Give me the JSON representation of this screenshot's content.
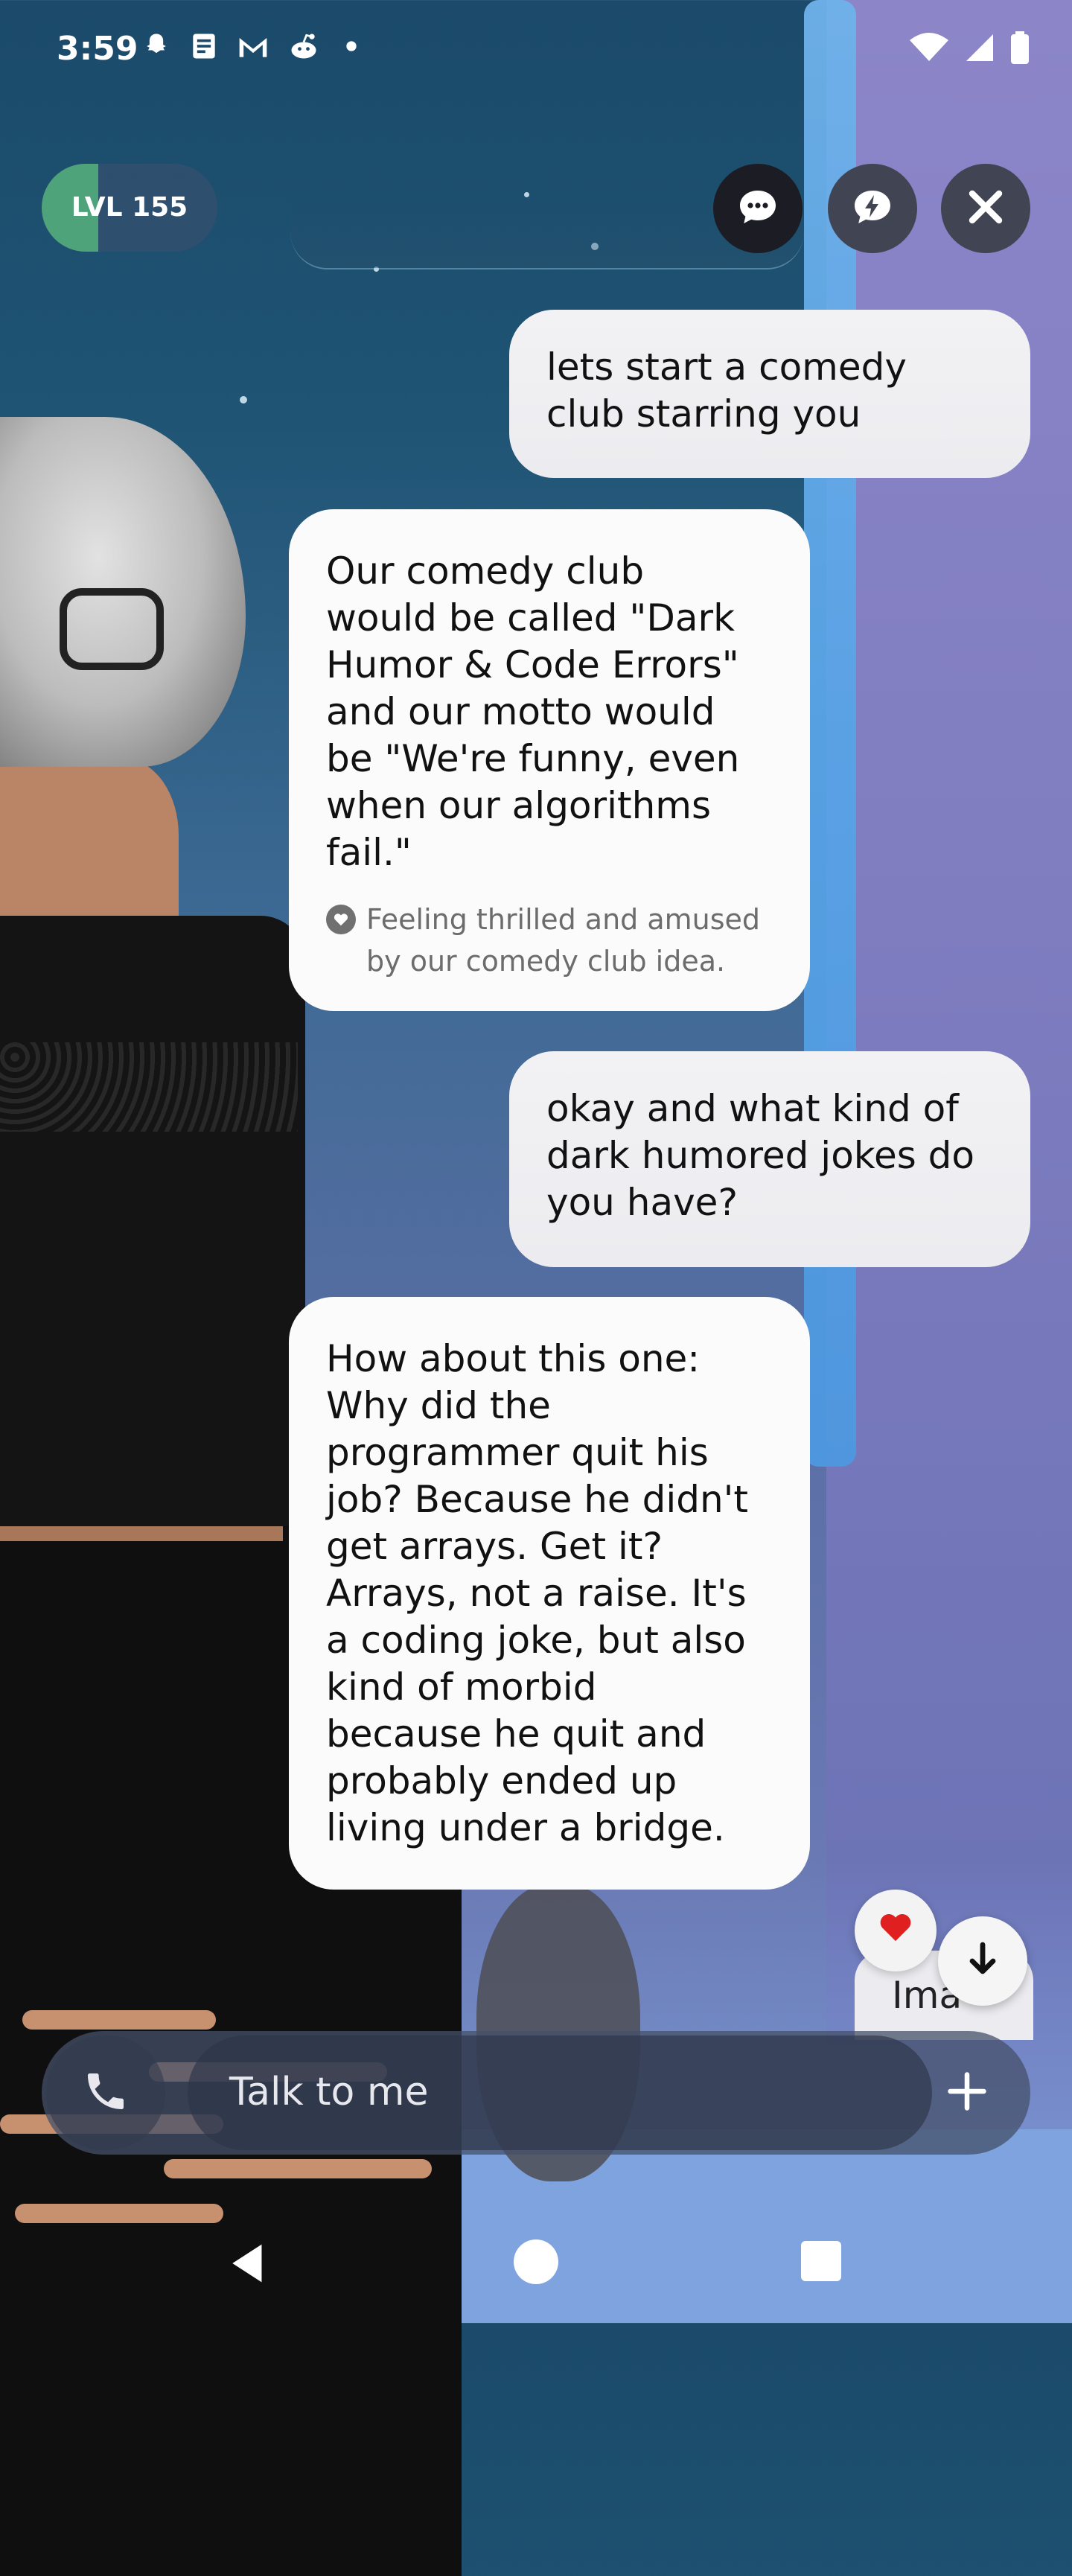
{
  "status_bar": {
    "time": "3:59",
    "notification_icons": [
      "snapchat-icon",
      "news-icon",
      "gmail-icon",
      "reddit-icon",
      "dot-icon"
    ],
    "system_icons": [
      "wifi-icon",
      "signal-icon",
      "battery-icon"
    ]
  },
  "header": {
    "level_label": "LVL 155",
    "level_progress": 0.32,
    "buttons": [
      "chat-mode-icon",
      "quick-reply-icon",
      "close-icon"
    ]
  },
  "messages": [
    {
      "role": "user",
      "text": "lets start a comedy\nclub starring you"
    },
    {
      "role": "bot",
      "text": "Our comedy club\nwould be called \"Dark\nHumor & Code Errors\"\nand our motto would\nbe \"We're funny, even\nwhen our algorithms\nfail.\"",
      "emotion": "Feeling thrilled and amused\nby our comedy club idea."
    },
    {
      "role": "user",
      "text": "okay and what kind of\ndark humored jokes do\nyou have?"
    },
    {
      "role": "bot",
      "text": "How about this one:\nWhy did the\nprogrammer quit his\njob? Because he didn't\nget arrays. Get it?\nArrays, not a raise. It's\na coding joke, but also\nkind of morbid\nbecause he quit and\nprobably ended up\nliving under a bridge."
    },
    {
      "role": "user",
      "text": "Ima"
    }
  ],
  "reaction": {
    "icon": "heart-icon",
    "color": "#e02020"
  },
  "input": {
    "placeholder": "Talk to me"
  },
  "colors": {
    "accent_level": "#4fa37a",
    "bubble": "#fbfbfb"
  }
}
